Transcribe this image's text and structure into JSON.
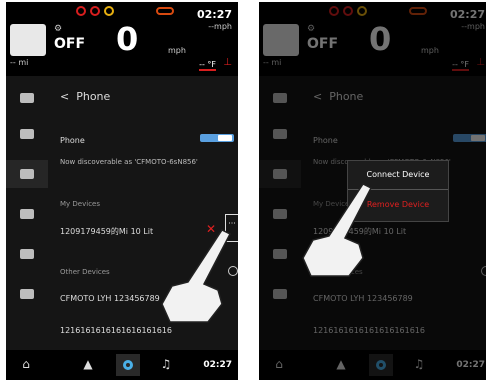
{
  "status": {
    "time": "02:27",
    "gear": "OFF",
    "speed": "0",
    "speed_unit": "mph",
    "speed_unit_top": "--mph",
    "temp": "-- °F",
    "fuel": "-- mi"
  },
  "phone": {
    "back_label": "<",
    "title": "Phone",
    "phone_label": "Phone",
    "discoverable": "Now discoverable as 'CFMOTO-6sN856'",
    "my_devices": "My Devices",
    "my_device_1": "1209179459的Mi 10 Lit",
    "other_devices": "Other Devices",
    "other_device_1": "CFMOTO LYH 123456789",
    "other_device_2": "1216161616161616161616",
    "delete_glyph": "✕",
    "more_glyph": "···"
  },
  "popup": {
    "connect": "Connect Device",
    "remove": "Remove Device"
  },
  "colors": {
    "accent": "#4ab0e8",
    "danger": "#e02020",
    "toggle": "#5aa0e0"
  }
}
